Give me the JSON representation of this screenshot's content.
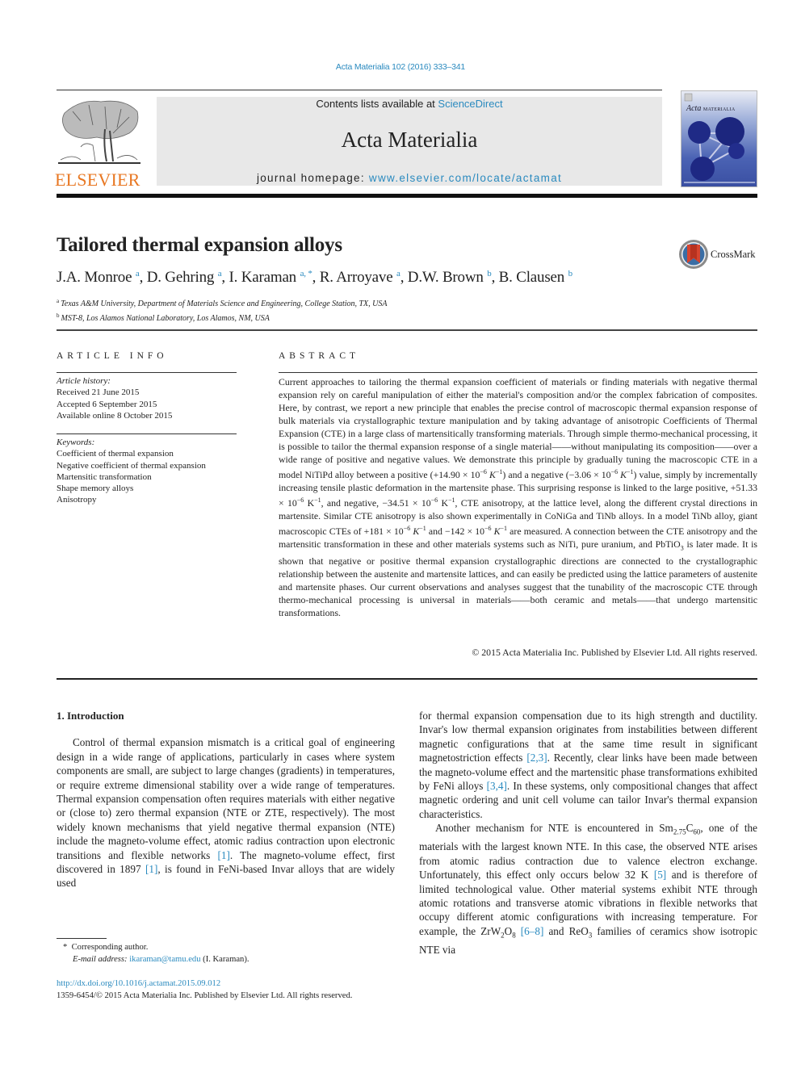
{
  "header": {
    "citation": "Acta Materialia 102 (2016) 333–341",
    "contents_prefix": "Contents lists available at ",
    "contents_link": "ScienceDirect",
    "journal_title": "Acta Materialia",
    "homepage_prefix": "journal homepage: ",
    "homepage_link": "www.elsevier.com/locate/actamat",
    "publisher_logo_text": "ELSEVIER",
    "cover_title": "Acta",
    "cover_subtitle": "MATERIALIA"
  },
  "article": {
    "title": "Tailored thermal expansion alloys",
    "crossmark_label": "CrossMark",
    "authors": [
      {
        "name": "J.A. Monroe",
        "aff": "a"
      },
      {
        "name": "D. Gehring",
        "aff": "a"
      },
      {
        "name": "I. Karaman",
        "aff": "a, *"
      },
      {
        "name": "R. Arroyave",
        "aff": "a"
      },
      {
        "name": "D.W. Brown",
        "aff": "b"
      },
      {
        "name": "B. Clausen",
        "aff": "b"
      }
    ],
    "affiliations": [
      {
        "key": "a",
        "text": "Texas A&M University, Department of Materials Science and Engineering, College Station, TX, USA"
      },
      {
        "key": "b",
        "text": "MST-8, Los Alamos National Laboratory, Los Alamos, NM, USA"
      }
    ]
  },
  "article_info": {
    "label": "ARTICLE INFO",
    "history_heading": "Article history:",
    "history": [
      "Received 21 June 2015",
      "Accepted 6 September 2015",
      "Available online 8 October 2015"
    ],
    "keywords_heading": "Keywords:",
    "keywords": [
      "Coefficient of thermal expansion",
      "Negative coefficient of thermal expansion",
      "Martensitic transformation",
      "Shape memory alloys",
      "Anisotropy"
    ]
  },
  "abstract": {
    "label": "ABSTRACT",
    "p1": "Current approaches to tailoring the thermal expansion coefficient of materials or finding materials with negative thermal expansion rely on careful manipulation of either the material's composition and/or the complex fabrication of composites. Here, by contrast, we report a new principle that enables the precise control of macroscopic thermal expansion response of bulk materials via crystallographic texture manipulation and by taking advantage of anisotropic Coefficients of Thermal Expansion (CTE) in a large class of martensitically transforming materials. Through simple thermo-mechanical processing, it is possible to tailor the thermal expansion response of a single material——without manipulating its composition——over a wide range of positive and negative values. We demonstrate this principle by gradually tuning the macroscopic CTE in a model NiTiPd alloy between a positive (",
    "v1": "+14.90 × 10",
    "p2": ") and a negative (",
    "v2": "−3.06 × 10",
    "p3": ") value, simply by incrementally increasing tensile plastic deformation in the martensite phase. This surprising response is linked to the large positive, ",
    "v3": "+51.33 × 10",
    "p4": ", and negative, ",
    "v4": "−34.51 × 10",
    "p5": ", CTE anisotropy, at the lattice level, along the different crystal directions in martensite. Similar CTE anisotropy is also shown experimentally in CoNiGa and TiNb alloys. In a model TiNb alloy, giant macroscopic CTEs of ",
    "v5": "+181 × 10",
    "p6": " and ",
    "v6": "−142 × 10",
    "p7": " are measured. A connection between the CTE anisotropy and the martensitic transformation in these and other materials systems such as NiTi, pure uranium, and PbTiO",
    "p7_sub": "3",
    "p8": " is later made. It is shown that negative or positive thermal expansion crystallographic directions are connected to the crystallographic relationship between the austenite and martensite lattices, and can easily be predicted using the lattice parameters of austenite and martensite phases. Our current observations and analyses suggest that the tunability of the macroscopic CTE through thermo-mechanical processing is universal in materials——both ceramic and metals——that undergo martensitic transformations.",
    "exp": "−6",
    "unit_K": "K",
    "unit_exp": "−1",
    "copyright": "© 2015 Acta Materialia Inc. Published by Elsevier Ltd. All rights reserved."
  },
  "body": {
    "intro_heading": "1.  Introduction",
    "left_p1a": "Control of thermal expansion mismatch is a critical goal of engineering design in a wide range of applications, particularly in cases where system components are small, are subject to large changes (gradients) in temperatures, or require extreme dimensional stability over a wide range of temperatures. Thermal expansion compensation often requires materials with either negative or (close to) zero thermal expansion (NTE or ZTE, respectively). The most widely known mechanisms that yield negative thermal expansion (NTE) include the magneto-volume effect, atomic radius contraction upon electronic transitions and flexible networks ",
    "ref1": "[1]",
    "left_p1b": ". The magneto-volume effect, first discovered in 1897 ",
    "ref1b": "[1]",
    "left_p1c": ", is found in FeNi-based Invar alloys that are widely used",
    "right_p1a": "for thermal expansion compensation due to its high strength and ductility. Invar's low thermal expansion originates from instabilities between different magnetic configurations that at the same time result in significant magnetostriction effects ",
    "ref23": "[2,3]",
    "right_p1b": ". Recently, clear links have been made between the magneto-volume effect and the martensitic phase transformations exhibited by FeNi alloys ",
    "ref34": "[3,4]",
    "right_p1c": ". In these systems, only compositional changes that affect magnetic ordering and unit cell volume can tailor Invar's thermal expansion characteristics.",
    "right_p2a": "Another mechanism for NTE is encountered in Sm",
    "sm_sub": "2.75",
    "right_p2b": "C",
    "c_sub": "60",
    "right_p2c": ", one of the materials with the largest known NTE. In this case, the observed NTE arises from atomic radius contraction due to valence electron exchange. Unfortunately, this effect only occurs below 32 K ",
    "ref5": "[5]",
    "right_p2d": " and is therefore of limited technological value. Other material systems exhibit NTE through atomic rotations and transverse atomic vibrations in flexible networks that occupy different atomic configurations with increasing temperature. For example, the ZrW",
    "w_sub": "2",
    "right_p2e": "O",
    "o_sub": "8",
    "ref68": "[6–8]",
    "right_p2f": " and ReO",
    "reo_sub": "3",
    "right_p2g": " families of ceramics show isotropic NTE via"
  },
  "footer": {
    "fn_mark": "*",
    "fn_text": "Corresponding author.",
    "email_label": "E-mail address:",
    "email": "ikaraman@tamu.edu",
    "email_suffix": " (I. Karaman).",
    "doi": "http://dx.doi.org/10.1016/j.actamat.2015.09.012",
    "issn_line": "1359-6454/© 2015 Acta Materialia Inc. Published by Elsevier Ltd. All rights reserved."
  },
  "colors": {
    "link": "#2a8abf",
    "elsevier_orange": "#e87722",
    "masthead_bg": "#e8e8e8"
  }
}
